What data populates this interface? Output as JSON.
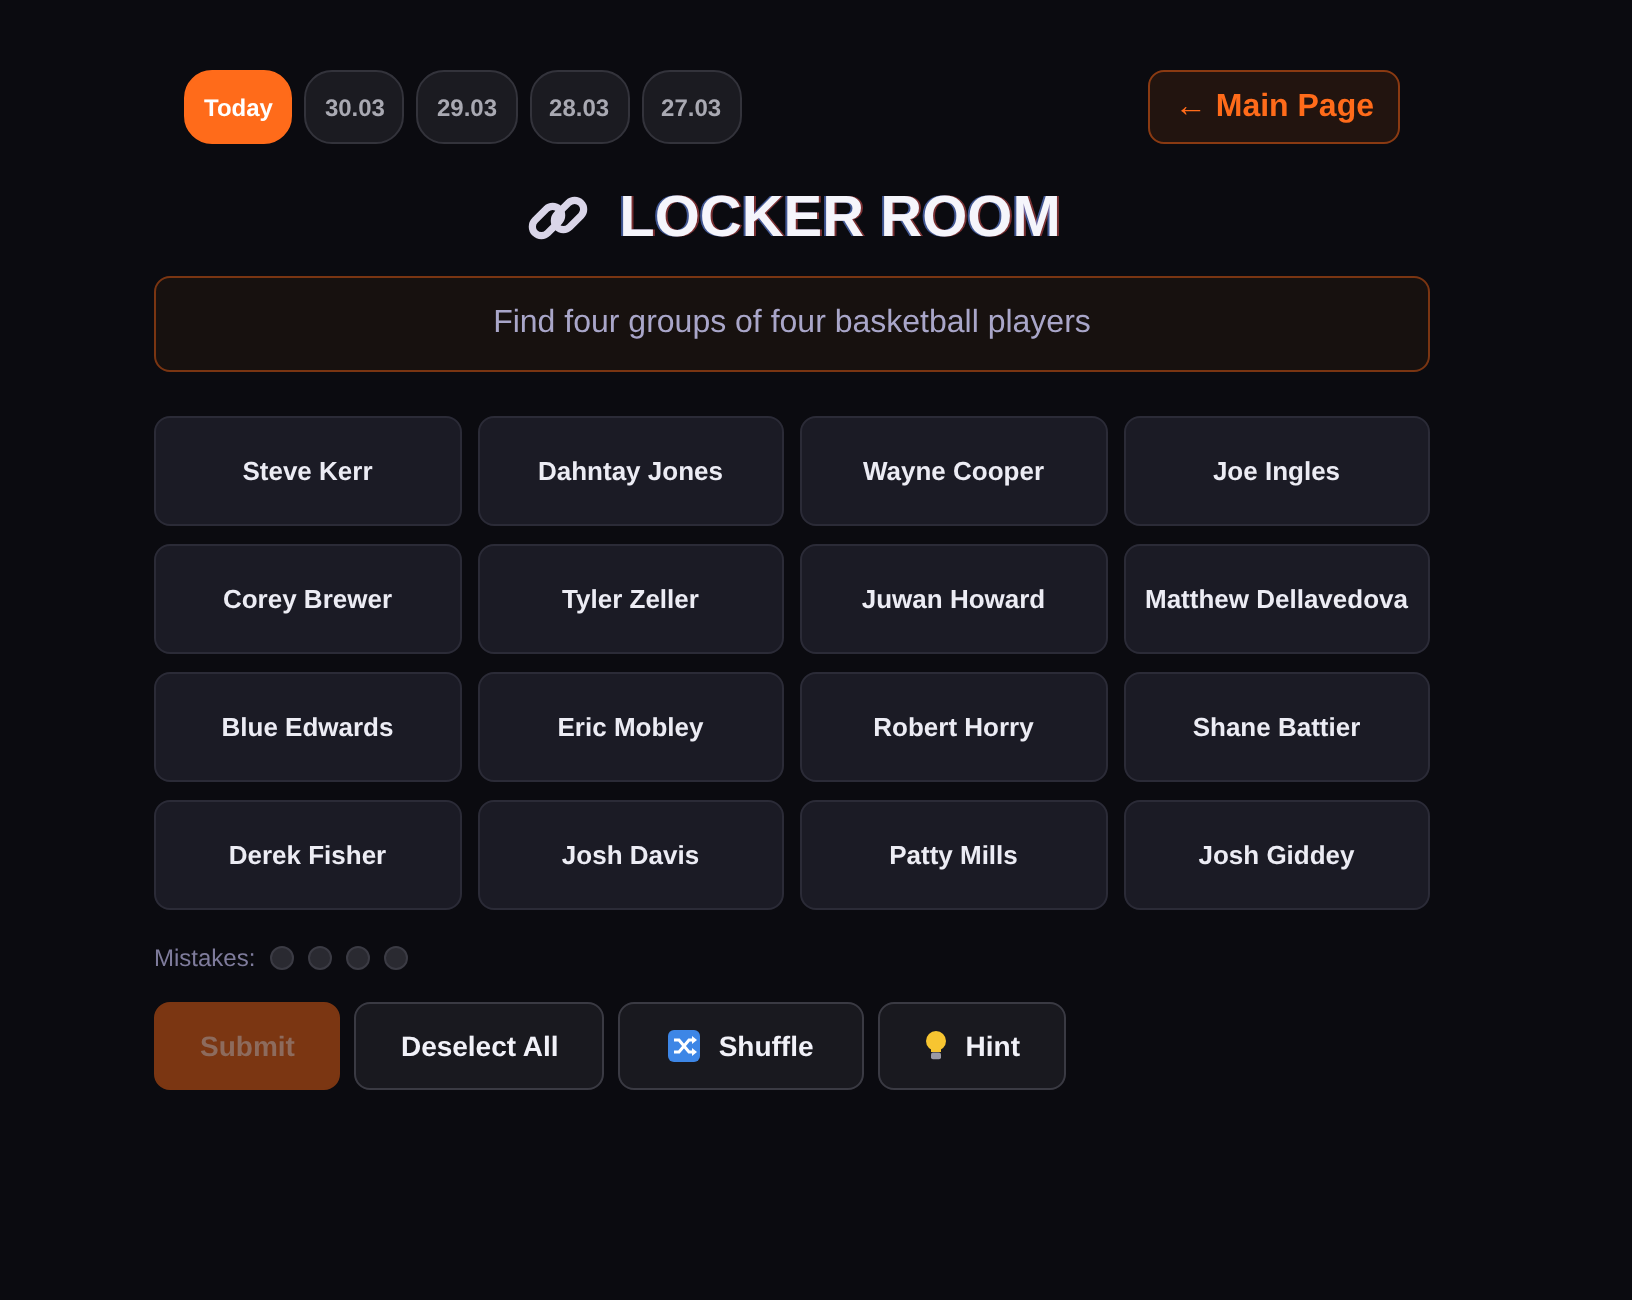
{
  "nav": {
    "date_tabs": [
      {
        "label": "Today",
        "selected": true
      },
      {
        "label": "30.03",
        "selected": false
      },
      {
        "label": "29.03",
        "selected": false
      },
      {
        "label": "28.03",
        "selected": false
      },
      {
        "label": "27.03",
        "selected": false
      }
    ],
    "main_page_button": {
      "label": "← Main Page"
    }
  },
  "title": "LOCKER ROOM",
  "instructions": "Find four groups of four basketball players",
  "tiles": [
    {
      "label": "Steve Kerr",
      "selected": false
    },
    {
      "label": "Dahntay Jones",
      "selected": false
    },
    {
      "label": "Wayne Cooper",
      "selected": false
    },
    {
      "label": "Joe Ingles",
      "selected": false
    },
    {
      "label": "Corey Brewer",
      "selected": false
    },
    {
      "label": "Tyler Zeller",
      "selected": false
    },
    {
      "label": "Juwan Howard",
      "selected": false
    },
    {
      "label": "Matthew Dellavedova",
      "selected": false
    },
    {
      "label": "Blue Edwards",
      "selected": false
    },
    {
      "label": "Eric Mobley",
      "selected": false
    },
    {
      "label": "Robert Horry",
      "selected": false
    },
    {
      "label": "Shane Battier",
      "selected": false
    },
    {
      "label": "Derek Fisher",
      "selected": false
    },
    {
      "label": "Josh Davis",
      "selected": false
    },
    {
      "label": "Patty Mills",
      "selected": false
    },
    {
      "label": "Josh Giddey",
      "selected": false
    }
  ],
  "mistakes": {
    "label": "Mistakes:",
    "dots": [
      {
        "used": false
      },
      {
        "used": false
      },
      {
        "used": false
      },
      {
        "used": false
      }
    ]
  },
  "actions": [
    {
      "kind": "submit",
      "label": "Submit",
      "disabled": true
    },
    {
      "kind": "deselect",
      "label": "Deselect All",
      "disabled": false
    },
    {
      "kind": "shuffle",
      "label": "Shuffle",
      "disabled": false
    },
    {
      "kind": "hint",
      "label": "Hint",
      "disabled": false
    }
  ]
}
